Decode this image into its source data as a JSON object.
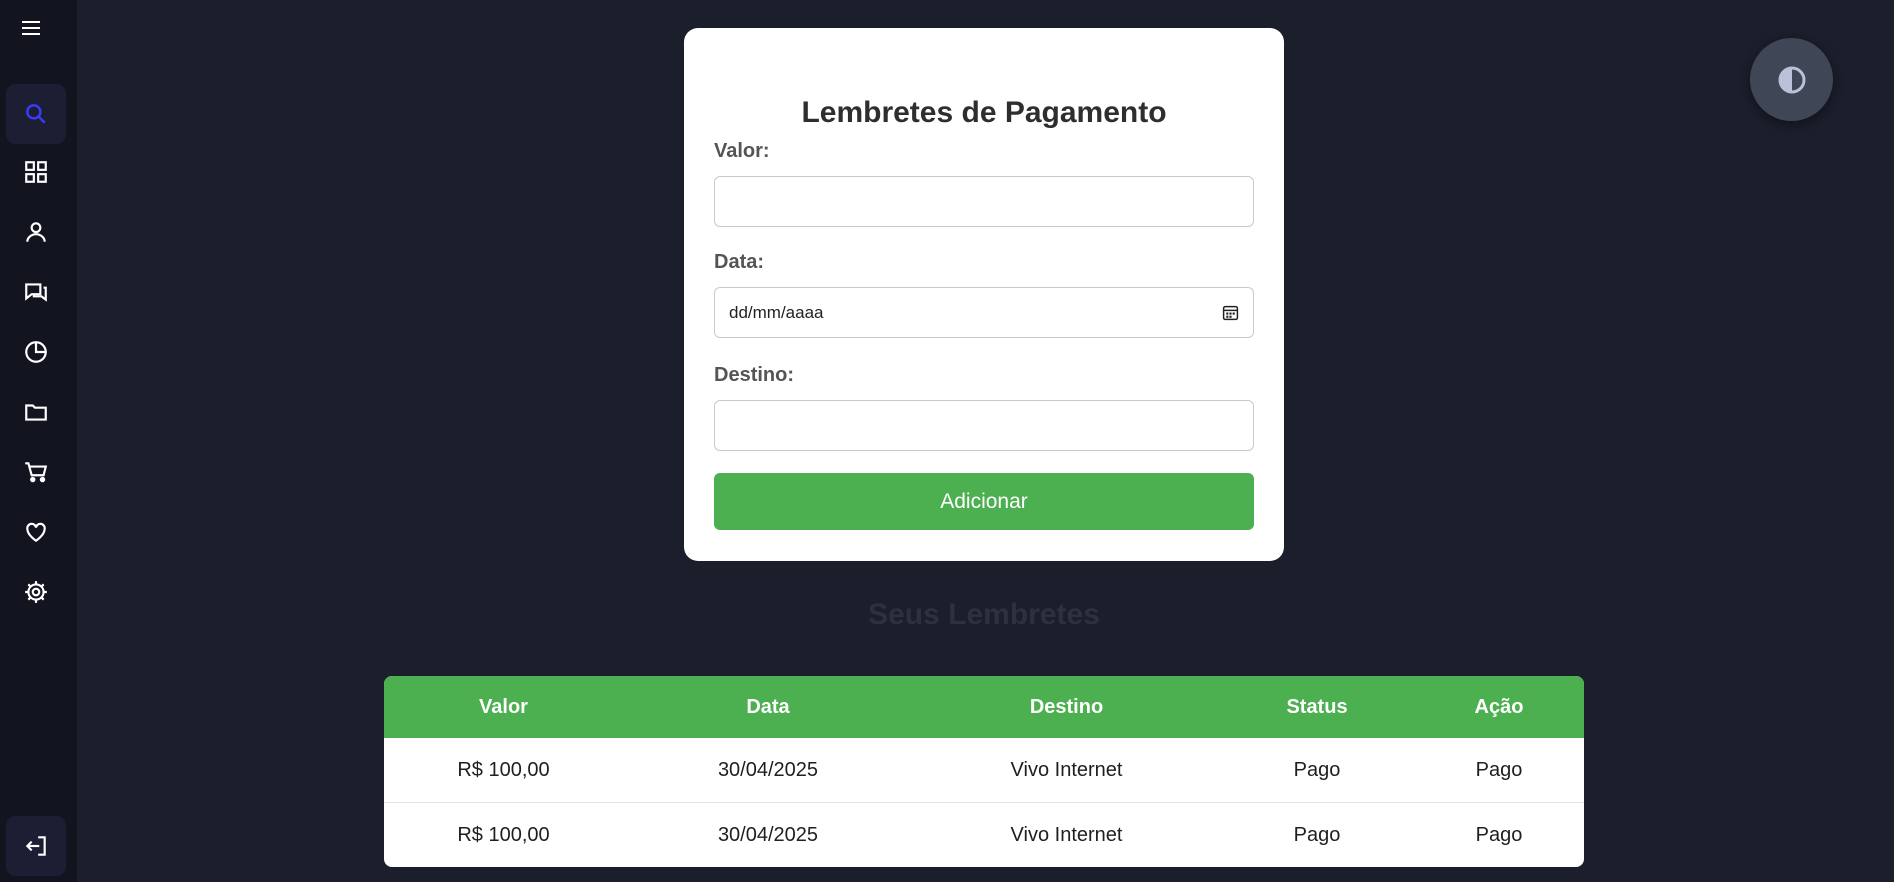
{
  "sidebar": {
    "icons": [
      "menu-icon",
      "search-icon",
      "dashboard-icon",
      "user-icon",
      "chat-icon",
      "pie-chart-icon",
      "folder-icon",
      "cart-icon",
      "heart-icon",
      "gear-icon",
      "logout-icon"
    ],
    "active_color": "#3b3bff"
  },
  "form": {
    "title": "Lembretes de Pagamento",
    "valor_label": "Valor:",
    "valor_value": "",
    "data_label": "Data:",
    "data_placeholder": "dd/mm/aaaa",
    "destino_label": "Destino:",
    "destino_value": "",
    "submit_label": "Adicionar",
    "accent": "#4caf50"
  },
  "theme_toggle": {
    "icon": "contrast-icon"
  },
  "reminders": {
    "title": "Seus Lembretes",
    "columns": [
      "Valor",
      "Data",
      "Destino",
      "Status",
      "Ação"
    ],
    "rows": [
      {
        "valor": "R$ 100,00",
        "data": "30/04/2025",
        "destino": "Vivo Internet",
        "status": "Pago",
        "acao": "Pago"
      },
      {
        "valor": "R$ 100,00",
        "data": "30/04/2025",
        "destino": "Vivo Internet",
        "status": "Pago",
        "acao": "Pago"
      }
    ]
  }
}
